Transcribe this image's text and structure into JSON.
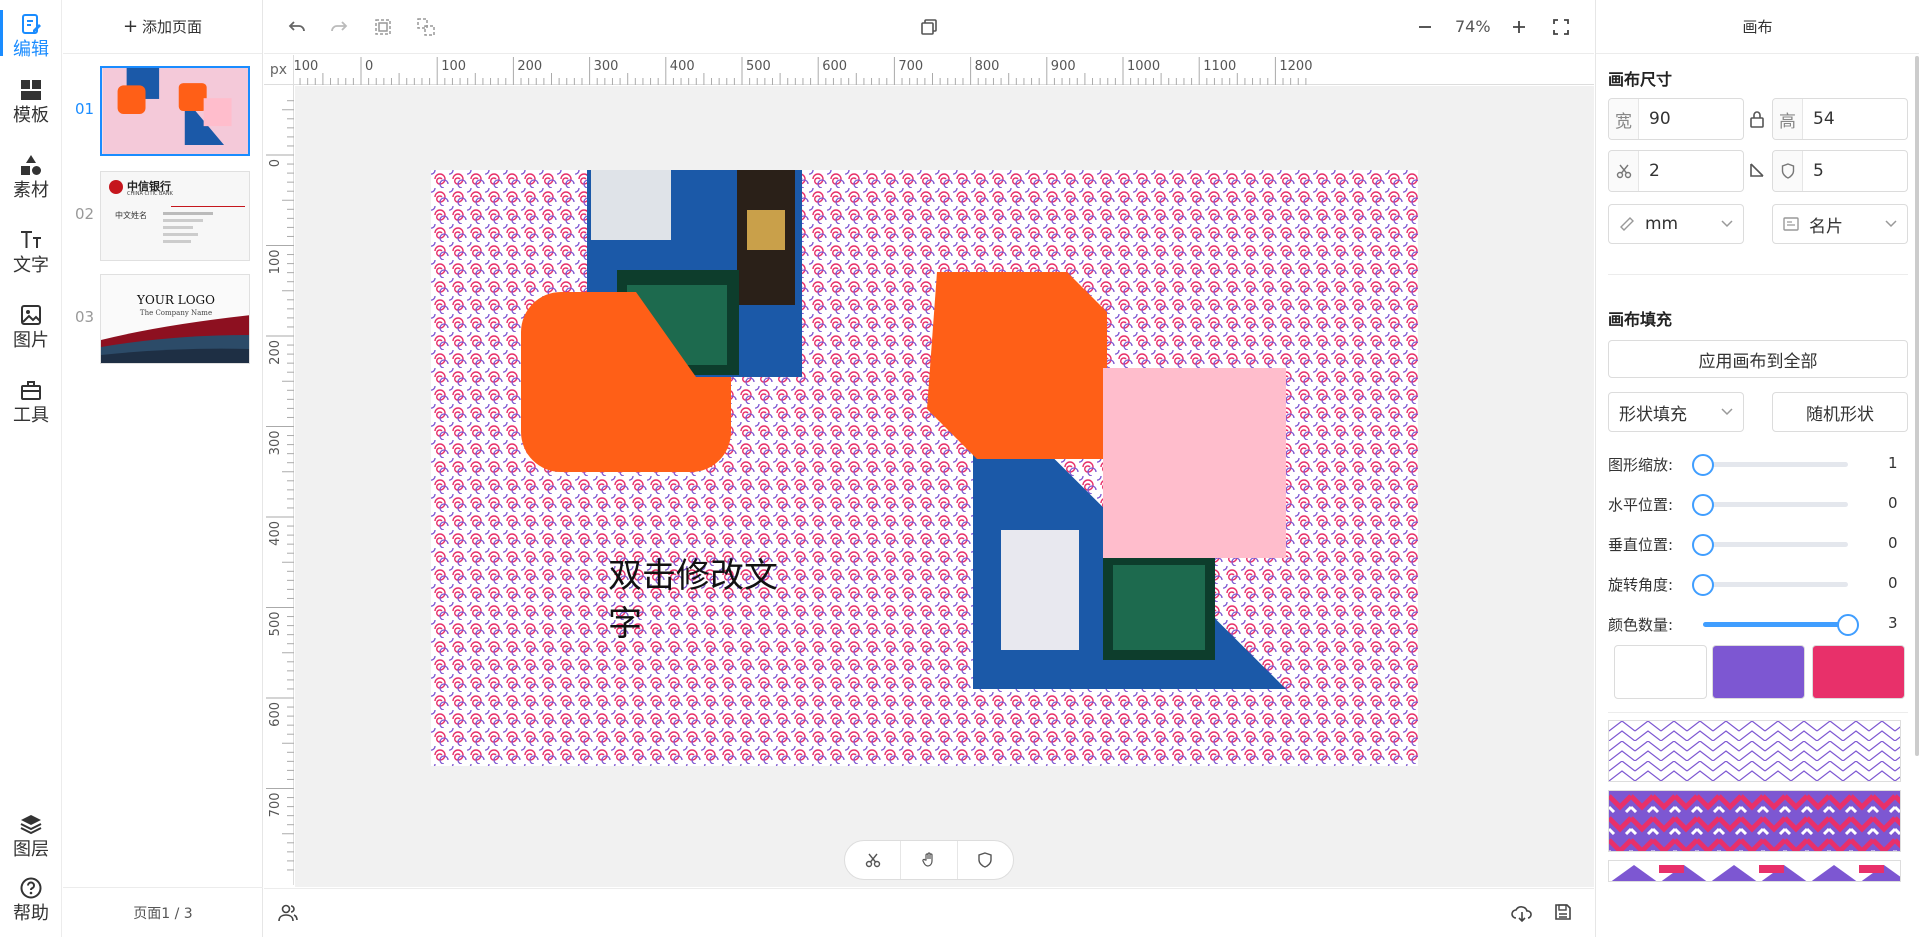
{
  "nav": {
    "items": [
      {
        "label": "编辑",
        "icon": "edit-icon"
      },
      {
        "label": "模板",
        "icon": "template-icon"
      },
      {
        "label": "素材",
        "icon": "shapes-icon"
      },
      {
        "label": "文字",
        "icon": "text-icon"
      },
      {
        "label": "图片",
        "icon": "image-icon"
      },
      {
        "label": "工具",
        "icon": "toolbox-icon"
      }
    ],
    "bottom": [
      {
        "label": "图层",
        "icon": "layers-icon"
      },
      {
        "label": "帮助",
        "icon": "help-icon"
      }
    ]
  },
  "pages": {
    "add_label": "添加页面",
    "items": [
      {
        "num": "01"
      },
      {
        "num": "02",
        "bank": "中信银行",
        "bank_en": "CHINA CITIC BANK",
        "name": "中文姓名"
      },
      {
        "num": "03",
        "logo": "YOUR LOGO",
        "company": "The Company Name"
      }
    ],
    "pager": "页面1 / 3"
  },
  "toolbar": {
    "zoom": "74%"
  },
  "ruler": {
    "unit": "px",
    "h_ticks": [
      "-100",
      "0",
      "100",
      "200",
      "300",
      "400",
      "500",
      "600",
      "700",
      "800",
      "900",
      "1000",
      "1100",
      "1200"
    ],
    "v_ticks": [
      "0",
      "100",
      "200",
      "300",
      "400",
      "500",
      "600",
      "700"
    ]
  },
  "canvas": {
    "text": "双击修改文字",
    "colors": {
      "pattern_a": "#e8306a",
      "pattern_b": "#7d57d2",
      "orange": "#ff5f17",
      "blue": "#1b59a8",
      "pink": "#ffbdcc"
    }
  },
  "panel": {
    "title": "画布",
    "size_title": "画布尺寸",
    "width_label": "宽",
    "width": "90",
    "height_label": "高",
    "height": "54",
    "bleed": "2",
    "radius": "5",
    "unit": "mm",
    "preset": "名片",
    "fill_title": "画布填充",
    "apply_all": "应用画布到全部",
    "fill_type": "形状填充",
    "random_shape": "随机形状",
    "sliders": [
      {
        "label": "图形缩放:",
        "value": "1",
        "pct": 0
      },
      {
        "label": "水平位置:",
        "value": "0",
        "pct": 0
      },
      {
        "label": "垂直位置:",
        "value": "0",
        "pct": 0
      },
      {
        "label": "旋转角度:",
        "value": "0",
        "pct": 0
      },
      {
        "label": "颜色数量:",
        "value": "3",
        "pct": 100
      }
    ],
    "swatches": [
      "#ffffff",
      "#7d57d2",
      "#e8306a"
    ]
  }
}
